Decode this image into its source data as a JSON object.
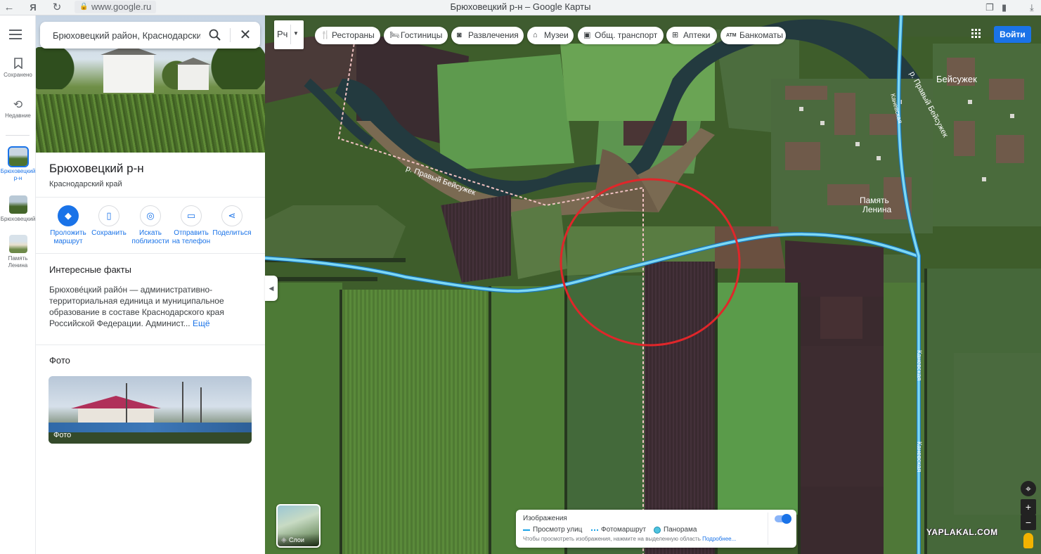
{
  "browser": {
    "url": "www.google.ru",
    "window_title": "Брюховецкий р-н – Google Карты"
  },
  "rail": {
    "saved_label": "Сохранено",
    "recent_label": "Недавние",
    "history_items": [
      {
        "label": "Брюховецкий р-н"
      },
      {
        "label": "Брюховецкий"
      },
      {
        "label": "Память Ленина"
      }
    ]
  },
  "search": {
    "value": "Брюховецкий район, Краснодарский край"
  },
  "place": {
    "title": "Брюховецкий р-н",
    "subtitle": "Краснодарский край"
  },
  "actions": [
    {
      "label": "Проложить маршрут",
      "icon": "directions-icon"
    },
    {
      "label": "Сохранить",
      "icon": "bookmark-icon"
    },
    {
      "label": "Искать поблизости",
      "icon": "nearby-icon"
    },
    {
      "label": "Отправить на телефон",
      "icon": "phone-icon"
    },
    {
      "label": "Поделиться",
      "icon": "share-icon"
    }
  ],
  "facts": {
    "heading": "Интересные факты",
    "text": "Брюхове́цкий райо́н — административно-территориальная единица и муниципальное образование в составе Краснодарского края Российской Федерации. Админист...",
    "more_label": "Ещё"
  },
  "photos": {
    "heading": "Фото",
    "photo_label": "Фото"
  },
  "map": {
    "type_glyph": "Рч",
    "chips": [
      {
        "label": "Рестораны",
        "icon": "restaurant-icon"
      },
      {
        "label": "Гостиницы",
        "icon": "hotel-icon"
      },
      {
        "label": "Развлечения",
        "icon": "camera-icon"
      },
      {
        "label": "Музеи",
        "icon": "museum-icon"
      },
      {
        "label": "Общ. транспорт",
        "icon": "transit-icon"
      },
      {
        "label": "Аптеки",
        "icon": "pharmacy-icon"
      },
      {
        "label": "Банкоматы",
        "icon": "atm-icon"
      }
    ],
    "atm_glyph": "ATM",
    "signin_label": "Войти",
    "labels": {
      "river_left": "р. Правый Бейсужек",
      "river_right": "р. Правый Бейсужек",
      "village_1": "Бейсужек",
      "village_2_line1": "Память",
      "village_2_line2": "Ленина",
      "road_1": "Каневская",
      "road_2": "Каневская",
      "road_3": "Каневская"
    },
    "layers_label": "Слои",
    "imagery": {
      "heading": "Изображения",
      "legend": [
        {
          "label": "Просмотр улиц"
        },
        {
          "label": "Фотомаршрут"
        },
        {
          "label": "Панорама"
        }
      ],
      "hint": "Чтобы просмотреть изображения, нажмите на выделенную область",
      "more_label": "Подробнее..."
    },
    "controls": {
      "locate": "⌖",
      "zoom_in": "+",
      "zoom_out": "−"
    },
    "watermark": "YAPLAKAL.COM"
  },
  "colors": {
    "accent": "#1a73e8",
    "road_overlay": "#5ecdf0",
    "marker_circle": "#e0262a"
  }
}
